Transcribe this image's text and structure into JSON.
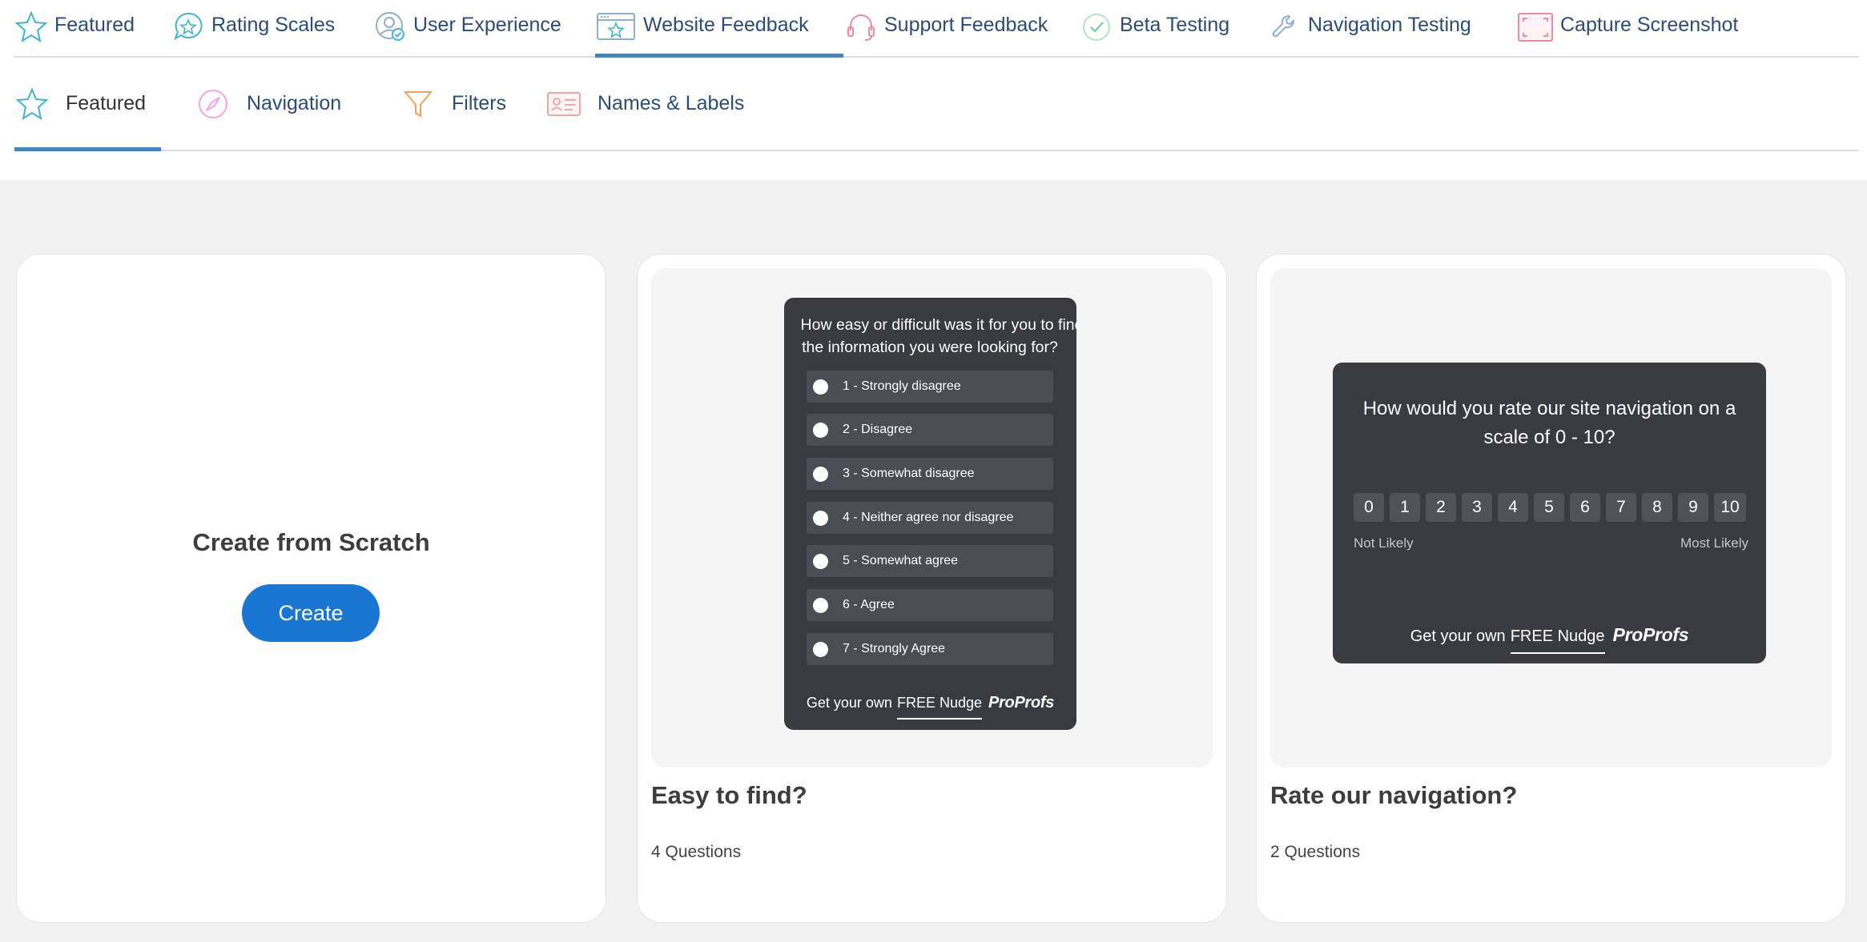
{
  "tabs": [
    {
      "label": "Featured",
      "icon": "star-icon",
      "active": false
    },
    {
      "label": "Rating Scales",
      "icon": "star-chat-icon",
      "active": false
    },
    {
      "label": "User Experience",
      "icon": "user-check-icon",
      "active": false
    },
    {
      "label": "Website Feedback",
      "icon": "browser-star-icon",
      "active": true
    },
    {
      "label": "Support Feedback",
      "icon": "headset-icon",
      "active": false
    },
    {
      "label": "Beta Testing",
      "icon": "check-circle-icon",
      "active": false
    },
    {
      "label": "Navigation Testing",
      "icon": "wrench-icon",
      "active": false
    },
    {
      "label": "Capture Screenshot",
      "icon": "screenshot-frame-icon",
      "active": false
    }
  ],
  "subtabs": [
    {
      "label": "Featured",
      "icon": "star-icon",
      "active": true
    },
    {
      "label": "Navigation",
      "icon": "compass-icon",
      "active": false
    },
    {
      "label": "Filters",
      "icon": "funnel-icon",
      "active": false
    },
    {
      "label": "Names & Labels",
      "icon": "id-card-icon",
      "active": false
    }
  ],
  "scratch_card": {
    "title": "Create from Scratch",
    "button_label": "Create"
  },
  "template_cards": [
    {
      "title": "Easy to find?",
      "subtitle": "4 Questions",
      "preview": {
        "question_line1": "How easy or difficult was it for you to find",
        "question_line2": "the information you were looking for?",
        "options": [
          "1 - Strongly disagree",
          "2 - Disagree",
          "3 - Somewhat disagree",
          "4 - Neither agree nor disagree",
          "5 - Somewhat agree",
          "6 - Agree",
          "7 - Strongly Agree"
        ],
        "footer_prefix": "Get your own",
        "footer_link": "FREE Nudge",
        "brand": "ProProfs"
      }
    },
    {
      "title": "Rate our navigation?",
      "subtitle": "2 Questions",
      "preview": {
        "question": "How would you rate our site navigation on a scale of 0 - 10?",
        "scale": [
          "0",
          "1",
          "2",
          "3",
          "4",
          "5",
          "6",
          "7",
          "8",
          "9",
          "10"
        ],
        "low_label": "Not Likely",
        "high_label": "Most Likely",
        "footer_prefix": "Get your own",
        "footer_link": "FREE Nudge",
        "brand": "ProProfs"
      }
    }
  ],
  "colors": {
    "accent": "#3e86c6",
    "button": "#1976d2",
    "widget_bg": "#393b40"
  }
}
